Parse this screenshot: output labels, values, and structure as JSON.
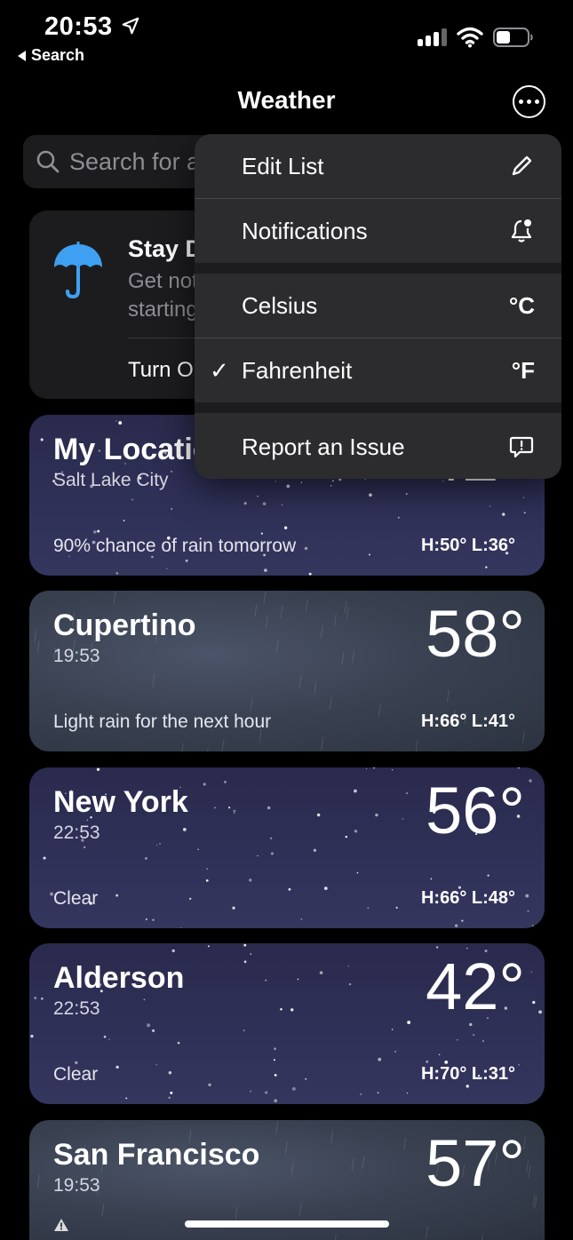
{
  "status_bar": {
    "time": "20:53",
    "back_label": "Search",
    "icons": [
      "location-arrow-icon",
      "cellular-signal-icon",
      "wifi-icon",
      "battery-icon"
    ]
  },
  "header": {
    "title": "Weather",
    "more_icon": "ellipsis-circle-icon"
  },
  "search": {
    "placeholder": "Search for a city or airport"
  },
  "notification_card": {
    "title": "Stay Dry",
    "text": "Get notified when rain or snow is starting",
    "action": "Turn On Notifications",
    "icon": "umbrella-icon"
  },
  "cities": [
    {
      "name": "My Location",
      "subtitle": "Salt Lake City",
      "temp": "42°",
      "condition": "90% chance of rain tomorrow",
      "high_low": "H:50°  L:36°",
      "style": "night"
    },
    {
      "name": "Cupertino",
      "subtitle": "19:53",
      "temp": "58°",
      "condition": "Light rain for the next hour",
      "high_low": "H:66°  L:41°",
      "style": "cloudy"
    },
    {
      "name": "New York",
      "subtitle": "22:53",
      "temp": "56°",
      "condition": "Clear",
      "high_low": "H:66°  L:48°",
      "style": "night"
    },
    {
      "name": "Alderson",
      "subtitle": "22:53",
      "temp": "42°",
      "condition": "Clear",
      "high_low": "H:70°  L:31°",
      "style": "night"
    },
    {
      "name": "San Francisco",
      "subtitle": "19:53",
      "temp": "57°",
      "style": "cloudy"
    }
  ],
  "menu": {
    "edit_list": "Edit List",
    "notifications": "Notifications",
    "celsius": "Celsius",
    "celsius_symbol": "°C",
    "fahrenheit": "Fahrenheit",
    "fahrenheit_symbol": "°F",
    "fahrenheit_checked": true,
    "report_issue": "Report an Issue"
  },
  "colors": {
    "night_card": "#2f3158",
    "cloudy_card": "#3a4252",
    "menu_bg": "#2c2c2e",
    "umbrella": "#3fa0f2"
  }
}
